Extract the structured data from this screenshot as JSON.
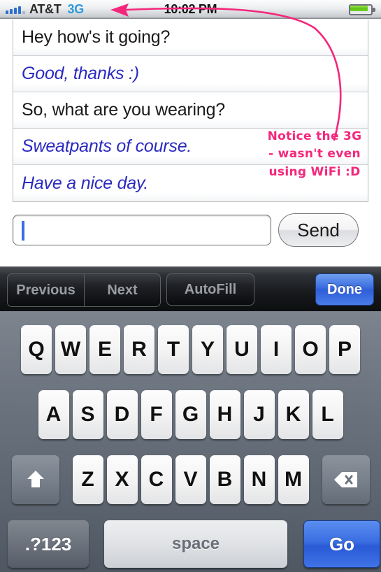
{
  "status_bar": {
    "signal_icon": "signal-bars-icon",
    "carrier": "AT&T",
    "network_mode": "3G",
    "time": "10:02 PM",
    "battery_icon": "battery-icon",
    "network_mode_color": "#2f9bdc"
  },
  "messages": [
    {
      "text": "Hey how's it going?",
      "style": "incoming"
    },
    {
      "text": "Good, thanks :)",
      "style": "reply"
    },
    {
      "text": "So, what are you wearing?",
      "style": "incoming"
    },
    {
      "text": "Sweatpants of course.",
      "style": "reply"
    },
    {
      "text": "Have a nice day.",
      "style": "reply"
    }
  ],
  "annotation": {
    "line1": "Notice the 3G",
    "line2": "- wasn't even",
    "line3": "using WiFi :D",
    "color": "#f4277c",
    "arrow_icon": "curved-arrow-icon"
  },
  "input_bar": {
    "field_value": "",
    "field_placeholder": "",
    "caret_color": "#3b6fe0",
    "send_label": "Send"
  },
  "keyboard_toolbar": {
    "previous_label": "Previous",
    "next_label": "Next",
    "autofill_label": "AutoFill",
    "done_label": "Done",
    "done_color": "#3d6fe0"
  },
  "keyboard": {
    "row1": [
      "Q",
      "W",
      "E",
      "R",
      "T",
      "Y",
      "U",
      "I",
      "O",
      "P"
    ],
    "row2": [
      "A",
      "S",
      "D",
      "F",
      "G",
      "H",
      "J",
      "K",
      "L"
    ],
    "row3": [
      "Z",
      "X",
      "C",
      "V",
      "B",
      "N",
      "M"
    ],
    "shift_icon": "shift-arrow-icon",
    "backspace_icon": "backspace-icon",
    "numeric_label": ".?123",
    "space_label": "space",
    "go_label": "Go",
    "go_color": "#3a6ee2"
  }
}
